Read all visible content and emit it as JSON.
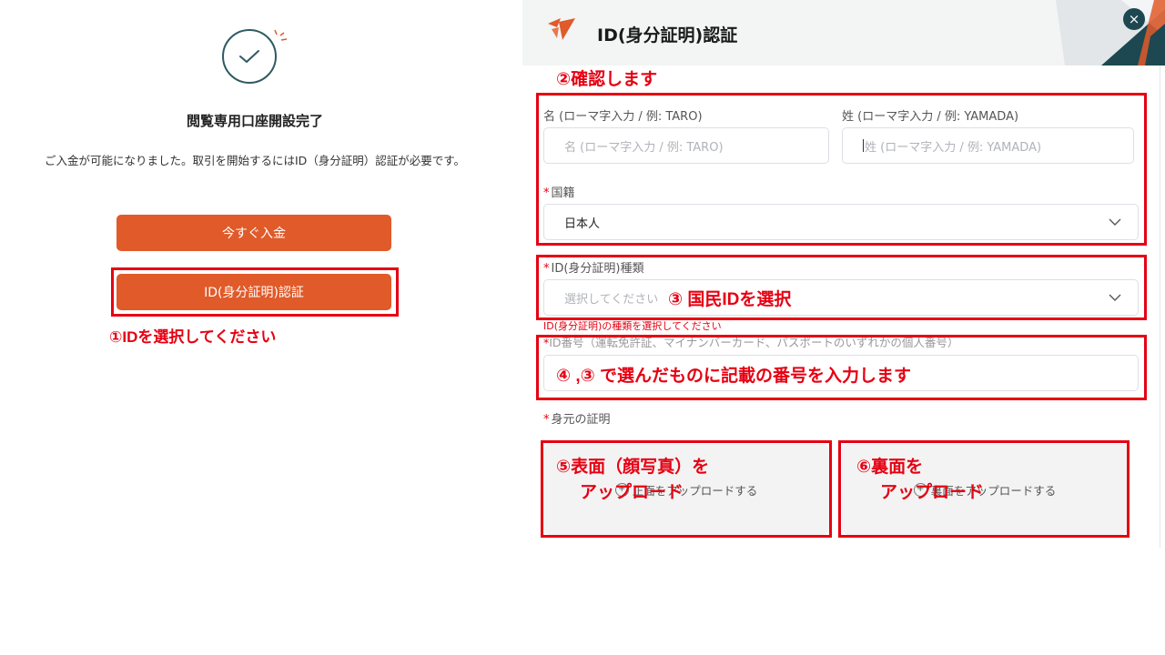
{
  "left": {
    "title": "閲覧専用口座開設完了",
    "description": "ご入金が可能になりました。取引を開始するにはID（身分証明）認証が必要です。",
    "deposit_button": "今すぐ入金",
    "id_button": "ID(身分証明)認証",
    "note_1": "①IDを選択してください"
  },
  "modal": {
    "title": "ID(身分証明)認証",
    "close": "×",
    "note_2": "②確認します",
    "given_name": {
      "label": "名 (ローマ字入力 / 例: TARO)",
      "placeholder": "名 (ローマ字入力 / 例: TARO)"
    },
    "family_name": {
      "label": "姓 (ローマ字入力 / 例: YAMADA)",
      "placeholder": "姓 (ローマ字入力 / 例: YAMADA)"
    },
    "nationality": {
      "required_mark": "*",
      "label": "国籍",
      "value": "日本人"
    },
    "id_type": {
      "required_mark": "*",
      "label": "ID(身分証明)種類",
      "placeholder": "選択してください",
      "error": "ID(身分証明)の種類を選択してください"
    },
    "note_3": "③ 国民IDを選択",
    "id_number": {
      "required_mark": "*",
      "label": "ID番号（運転免許証、マイナンバーカード、パスポートのいずれかの個人番号）"
    },
    "note_4": "④ ,③ で選んだものに記載の番号を入力します",
    "proof": {
      "required_mark": "*",
      "label": "身元の証明"
    },
    "upload_front": "正面をアップロードする",
    "upload_back": "裏面をアップロードする",
    "note_5_line1": "⑤表面（顔写真）を",
    "note_5_line2": "アップロード",
    "note_6_line1": "⑥裏面を",
    "note_6_line2": "アップロード"
  },
  "colors": {
    "accent": "#e05a2a",
    "annotation_red": "#e60012",
    "teal": "#1d4851"
  }
}
